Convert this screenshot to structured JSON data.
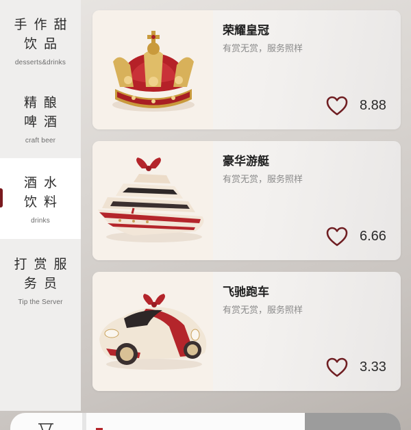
{
  "sidebar": {
    "items": [
      {
        "cn": "手作甜\n饮品",
        "en": "desserts&drinks",
        "active": false
      },
      {
        "cn": "精酿\n啤酒",
        "en": "craft beer",
        "active": false
      },
      {
        "cn": "酒水\n饮料",
        "en": "drinks",
        "active": true
      },
      {
        "cn": "打赏服\n务员",
        "en": "Tip the Server",
        "active": false
      }
    ]
  },
  "products": [
    {
      "title": "荣耀皇冠",
      "subtitle": "有赏无赏，服务照样",
      "price": "8.88",
      "image": "crown-image"
    },
    {
      "title": "豪华游艇",
      "subtitle": "有赏无赏，服务照样",
      "price": "6.66",
      "image": "yacht-image"
    },
    {
      "title": "飞驰跑车",
      "subtitle": "有赏无赏，服务照样",
      "price": "3.33",
      "image": "sports-car-image"
    }
  ],
  "colors": {
    "accent": "#7a1a1f",
    "heart": "#6f1e22",
    "active_bg": "#ffffff"
  }
}
